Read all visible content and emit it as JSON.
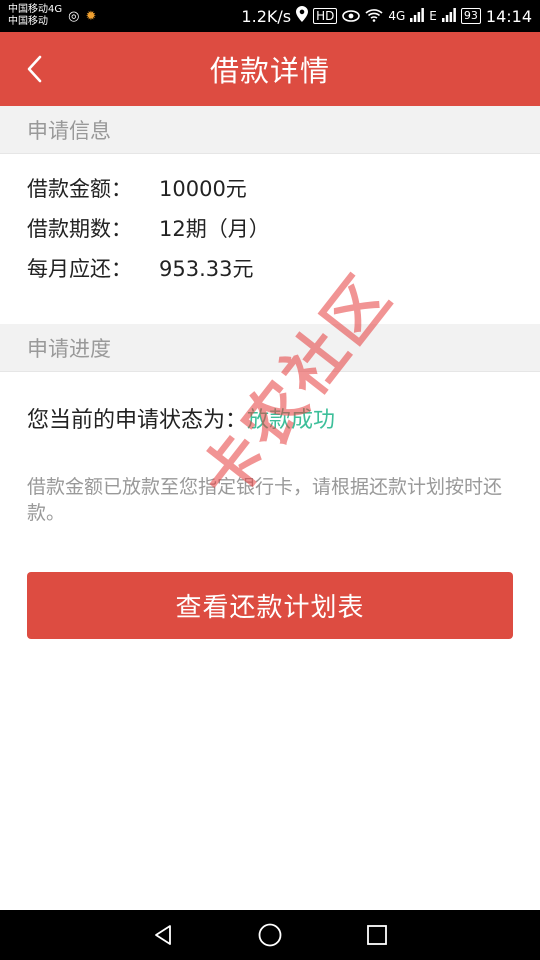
{
  "status_bar": {
    "carrier_1": "中国移动4G",
    "carrier_2": "中国移动",
    "speed": "1.2K/s",
    "hd": "HD",
    "net_1": "4G",
    "net_2": "E",
    "battery": "93",
    "time": "14:14"
  },
  "header": {
    "title": "借款详情"
  },
  "application_info": {
    "section_title": "申请信息",
    "rows": [
      {
        "label": "借款金额：",
        "value": "10000元"
      },
      {
        "label": "借款期数：",
        "value": "12期（月）"
      },
      {
        "label": "每月应还：",
        "value": "953.33元"
      }
    ]
  },
  "progress": {
    "section_title": "申请进度",
    "status_label": "您当前的申请状态为：",
    "status_value": "放款成功",
    "status_color": "#3dbf9a",
    "note": "借款金额已放款至您指定银行卡，请根据还款计划按时还款。"
  },
  "actions": {
    "plan_button_label": "查看还款计划表"
  },
  "watermark": {
    "text": "卡农社区"
  },
  "colors": {
    "brand": "#dd4c41",
    "section_bg": "#f2f2f2"
  }
}
